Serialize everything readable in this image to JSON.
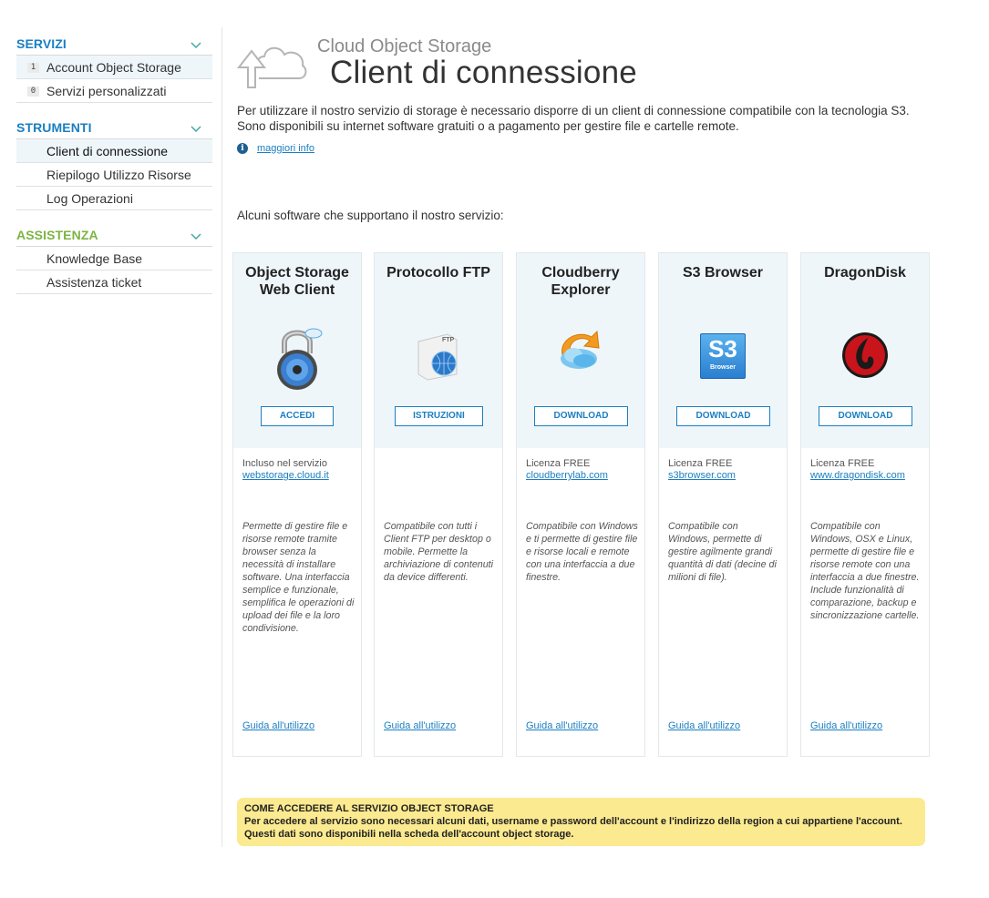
{
  "sidebar": {
    "sections": [
      {
        "title": "SERVIZI",
        "color": "#1a7fc2",
        "items": [
          {
            "badge": "1",
            "label": "Account Object Storage"
          },
          {
            "badge": "0",
            "label": "Servizi personalizzati"
          }
        ]
      },
      {
        "title": "STRUMENTI",
        "color": "#1a7fc2",
        "items": [
          {
            "label": "Client di connessione",
            "active": true
          },
          {
            "label": "Riepilogo Utilizzo Risorse"
          },
          {
            "label": "Log Operazioni"
          }
        ]
      },
      {
        "title": "ASSISTENZA",
        "color": "#7cb442",
        "items": [
          {
            "label": "Knowledge Base"
          },
          {
            "label": "Assistenza ticket"
          }
        ]
      }
    ]
  },
  "header": {
    "subtitle": "Cloud Object Storage",
    "title": "Client di connessione",
    "icon": "cloud-upload-icon"
  },
  "intro": {
    "line1": "Per utilizzare il nostro servizio di storage è necessario disporre di un client di connessione compatibile con la tecnologia S3.",
    "line2": "Sono disponibili su internet software gratuiti o a pagamento per gestire file e cartelle remote.",
    "info_link": "maggiori info"
  },
  "software_label": "Alcuni software che supportano il nostro servizio:",
  "cards": [
    {
      "title": "Object Storage Web Client",
      "logo": "padlock-icon",
      "button": "ACCEDI",
      "license": "Incluso nel servizio",
      "link": "webstorage.cloud.it",
      "description": "Permette di gestire file e risorse remote tramite browser senza la necessità di installare software. Una interfaccia semplice e funzionale, semplifica le operazioni di upload dei file e la loro condivisione.",
      "guide": "Guida all'utilizzo"
    },
    {
      "title": "Protocollo FTP",
      "logo": "ftp-globe-icon",
      "button": "ISTRUZIONI",
      "license": "",
      "link": "",
      "description": "Compatibile con tutti i Client FTP per desktop o mobile. Permette la archiviazione di contenuti da device differenti.",
      "guide": "Guida all'utilizzo"
    },
    {
      "title": "Cloudberry Explorer",
      "logo": "cloudberry-icon",
      "button": "DOWNLOAD",
      "license": "Licenza FREE",
      "link": "cloudberrylab.com",
      "description": "Compatibile con Windows e ti permette di gestire file e risorse locali e remote con una interfaccia a due finestre.",
      "guide": "Guida all'utilizzo"
    },
    {
      "title": "S3 Browser",
      "logo": "s3-browser-icon",
      "logo_text": "S3",
      "logo_sub": "Browser",
      "button": "DOWNLOAD",
      "license": "Licenza FREE",
      "link": "s3browser.com",
      "description": "Compatibile con Windows, permette di gestire agilmente grandi quantità di dati (decine di milioni di file).",
      "guide": "Guida all'utilizzo"
    },
    {
      "title": "DragonDisk",
      "logo": "dragondisk-icon",
      "button": "DOWNLOAD",
      "license": "Licenza FREE",
      "link": "www.dragondisk.com",
      "description": "Compatibile con Windows, OSX e Linux, permette di gestire file e risorse remote con una interfaccia a due finestre. Include funzionalità di comparazione, backup e sincronizzazione cartelle.",
      "guide": "Guida all'utilizzo"
    }
  ],
  "notice": {
    "title": "COME ACCEDERE AL SERVIZIO OBJECT STORAGE",
    "line1": "Per accedere al servizio sono necessari alcuni dati, username e password dell'account e l'indirizzo della region a cui appartiene l'account.",
    "line2": "Questi dati sono disponibili nella scheda dell'account object storage."
  },
  "colors": {
    "accent": "#1a7fc2",
    "green": "#7cb442",
    "card_bg": "#eff6fa",
    "notice_bg": "#fbea8f"
  }
}
